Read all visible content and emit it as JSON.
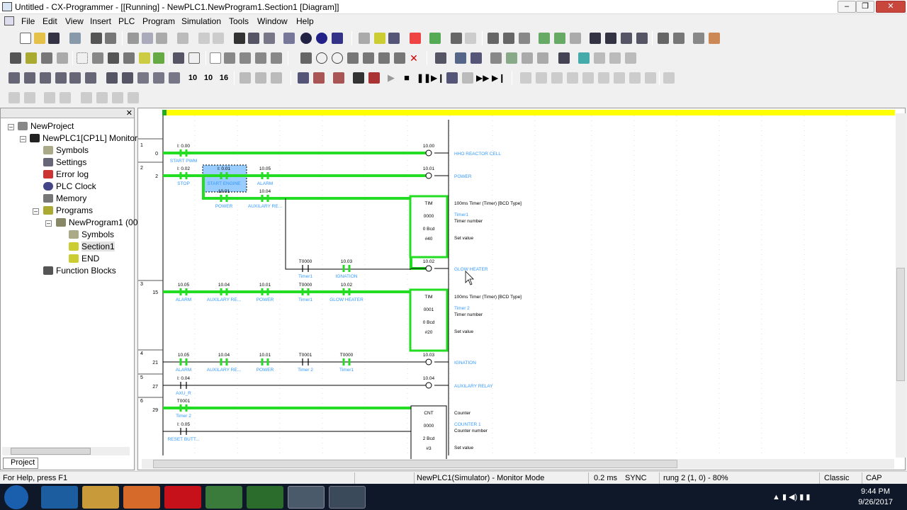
{
  "window": {
    "title": "Untitled - CX-Programmer - [[Running] - NewPLC1.NewProgram1.Section1 [Diagram]]",
    "controls": [
      "–",
      "❐",
      "✕"
    ]
  },
  "menu": [
    "File",
    "Edit",
    "View",
    "Insert",
    "PLC",
    "Program",
    "Simulation",
    "Tools",
    "Window",
    "Help"
  ],
  "project_tree": {
    "items": [
      {
        "label": "NewProject",
        "icon": "project-icon"
      },
      {
        "label": "NewPLC1[CP1L] Monitor",
        "icon": "plc-icon"
      },
      {
        "label": "Symbols",
        "icon": "symbols-icon"
      },
      {
        "label": "Settings",
        "icon": "settings-icon"
      },
      {
        "label": "Error log",
        "icon": "error-log-icon"
      },
      {
        "label": "PLC Clock",
        "icon": "clock-icon"
      },
      {
        "label": "Memory",
        "icon": "memory-icon"
      },
      {
        "label": "Programs",
        "icon": "programs-icon"
      },
      {
        "label": "NewProgram1 (00",
        "icon": "program-icon"
      },
      {
        "label": "Symbols",
        "icon": "symbols-icon"
      },
      {
        "label": "Section1",
        "icon": "section-icon"
      },
      {
        "label": "END",
        "icon": "section-icon"
      },
      {
        "label": "Function Blocks",
        "icon": "function-blocks-icon"
      }
    ],
    "selected_item": "Section1",
    "tab": "Project"
  },
  "ladder": {
    "rungs": [
      {
        "rung": "1",
        "step": "0"
      },
      {
        "rung": "2",
        "step": "2"
      },
      {
        "rung": "3",
        "step": "15"
      },
      {
        "rung": "4",
        "step": "21"
      },
      {
        "rung": "5",
        "step": "27"
      },
      {
        "rung": "6",
        "step": "29"
      }
    ],
    "contacts": [
      {
        "addr": "I: 0.00",
        "name": "START PWM"
      },
      {
        "addr": "I: 0.02",
        "name": "STOP"
      },
      {
        "addr": "I: 0.01",
        "name": "START ENGINE"
      },
      {
        "addr": "10.05",
        "name": "ALARM"
      },
      {
        "addr": "10.01",
        "name": "POWER"
      },
      {
        "addr": "10.04",
        "name": "AUXILARY RE..."
      },
      {
        "addr": "T0000",
        "name": "Timer1"
      },
      {
        "addr": "10.03",
        "name": "IGNATION"
      },
      {
        "addr": "10.05",
        "name": "ALARM"
      },
      {
        "addr": "10.04",
        "name": "AUXILARY RE..."
      },
      {
        "addr": "10.01",
        "name": "POWER"
      },
      {
        "addr": "T0000",
        "name": "Timer1"
      },
      {
        "addr": "10.02",
        "name": "GLOW HEATER"
      },
      {
        "addr": "10.05",
        "name": "ALARM"
      },
      {
        "addr": "10.04",
        "name": "AUXILARY RE..."
      },
      {
        "addr": "10.01",
        "name": "POWER"
      },
      {
        "addr": "T0001",
        "name": "Timer 2"
      },
      {
        "addr": "T0000",
        "name": "Timer1"
      },
      {
        "addr": "I: 0.04",
        "name": "AXU_R"
      },
      {
        "addr": "T0001",
        "name": "Timer 2"
      },
      {
        "addr": "I: 0.05",
        "name": "RESET BUTT..."
      }
    ],
    "coils": [
      {
        "addr": "10.00",
        "name": "HHO REACTOR CELL"
      },
      {
        "addr": "10.01",
        "name": "POWER"
      },
      {
        "addr": "10.02",
        "name": "GLOW HEATER"
      },
      {
        "addr": "10.03",
        "name": "IGNATION"
      },
      {
        "addr": "10.04",
        "name": "AUXILARY RELAY"
      }
    ],
    "blocks": [
      {
        "op": "TIM",
        "num": "0000",
        "val": "0 Bcd",
        "set": "#40",
        "desc": "100ms Timer (Timer) [BCD Type]",
        "sym": "Timer1",
        "l1": "Timer number",
        "l2": "Set value"
      },
      {
        "op": "TIM",
        "num": "0001",
        "val": "0 Bcd",
        "set": "#20",
        "desc": "100ms Timer (Timer) [BCD Type]",
        "sym": "Timer 2",
        "l1": "Timer number",
        "l2": "Set value"
      },
      {
        "op": "CNT",
        "num": "0000",
        "val": "2 Bcd",
        "set": "#3",
        "desc": "Counter",
        "sym": "COUNTER 1",
        "l1": "Counter number",
        "l2": "Set value"
      }
    ]
  },
  "status": {
    "help": "For Help, press F1",
    "mode": "NewPLC1(Simulator) - Monitor Mode",
    "cycle": "0.2 ms",
    "sync": "SYNC",
    "rung": "rung 2 (1, 0)  - 80%",
    "style": "Classic",
    "cap": "CAP"
  },
  "taskbar": {
    "time": "9:44 PM",
    "date": "9/26/2017"
  },
  "colors": {
    "energized": "#22dd22",
    "symbol": "#3399ff",
    "highlight": "#ffff00",
    "selection": "#99ccff"
  }
}
